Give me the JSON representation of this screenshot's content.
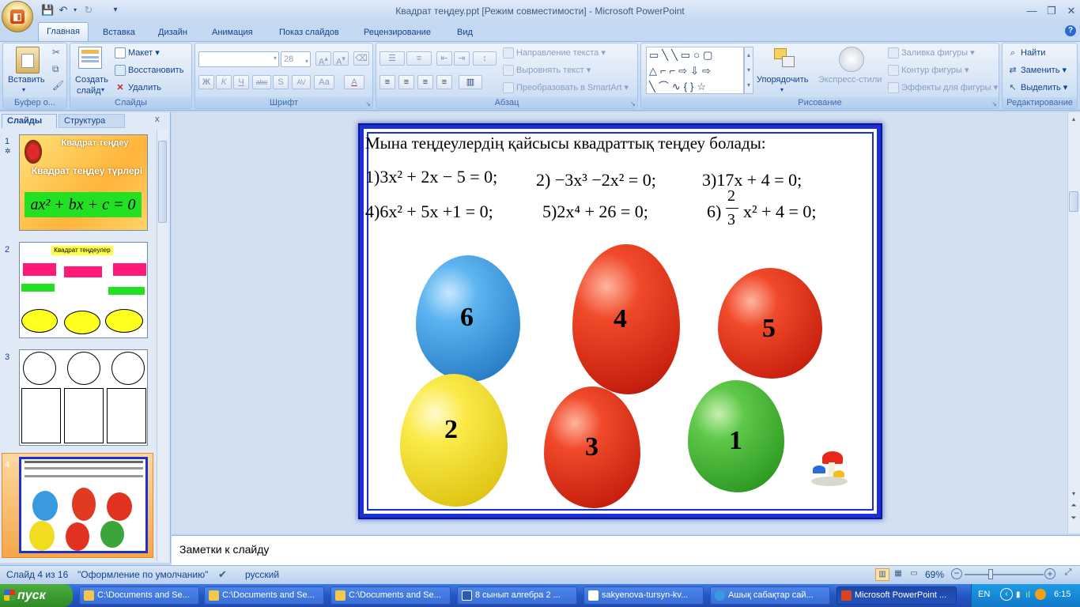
{
  "window": {
    "title": "Квадрат теңдеу.ppt [Режим совместимости] - Microsoft PowerPoint"
  },
  "tabs": [
    "Главная",
    "Вставка",
    "Дизайн",
    "Анимация",
    "Показ слайдов",
    "Рецензирование",
    "Вид"
  ],
  "ribbon": {
    "clipboard": {
      "label": "Буфер о...",
      "paste": "Вставить"
    },
    "slides": {
      "label": "Слайды",
      "new_slide_1": "Создать",
      "new_slide_2": "слайд",
      "layout": "Макет",
      "reset": "Восстановить",
      "delete": "Удалить"
    },
    "font": {
      "label": "Шрифт",
      "font_size": "28"
    },
    "paragraph": {
      "label": "Абзац",
      "text_direction": "Направление текста",
      "align_text": "Выровнять текст",
      "smartart": "Преобразовать в SmartArt"
    },
    "drawing": {
      "label": "Рисование",
      "arrange": "Упорядочить",
      "quick_styles": "Экспресс-стили",
      "shape_fill": "Заливка фигуры",
      "shape_outline": "Контур фигуры",
      "shape_effects": "Эффекты для фигуры"
    },
    "editing": {
      "label": "Редактирование",
      "find": "Найти",
      "replace": "Заменить",
      "select": "Выделить"
    }
  },
  "left_panel": {
    "tab_slides": "Слайды",
    "tab_outline": "Структура",
    "thumbs": [
      {
        "num": "1",
        "title_line1": "Квадрат теңдеу",
        "title_line2": "Квадрат теңдеу түрлері",
        "formula": "ax² + bx + c = 0"
      },
      {
        "num": "2",
        "title": "Квадрат теңдеулер"
      },
      {
        "num": "3"
      },
      {
        "num": "4"
      }
    ]
  },
  "slide": {
    "heading": "Мына теңдеулердің қайсысы квадраттық теңдеу болады:",
    "eq1": "1)3x² + 2x − 5 = 0;",
    "eq2": "2) −3x³ −2x² = 0;",
    "eq3": "3)17x + 4 = 0;",
    "eq4": "4)6x² + 5x +1 = 0;",
    "eq5": "5)2x⁴ + 26 = 0;",
    "eq6_prefix": "6)",
    "eq6_num": "2",
    "eq6_den": "3",
    "eq6_rest": "x² + 4 = 0;",
    "balloons": [
      {
        "label": "6",
        "color": "#3a9ae0"
      },
      {
        "label": "4",
        "color": "#e03a22"
      },
      {
        "label": "5",
        "color": "#e0321e"
      },
      {
        "label": "2",
        "color": "#f2dc22"
      },
      {
        "label": "3",
        "color": "#e0321e"
      },
      {
        "label": "1",
        "color": "#3aa53a"
      }
    ]
  },
  "notes": {
    "placeholder": "Заметки к слайду"
  },
  "statusbar": {
    "slide_info": "Слайд 4 из 16",
    "theme": "\"Оформление по умолчанию\"",
    "language": "русский",
    "zoom": "69%"
  },
  "taskbar": {
    "start": "пуск",
    "tasks": [
      "C:\\Documents and Se...",
      "C:\\Documents and Se...",
      "C:\\Documents and Se...",
      "8 сынып алгебра 2 ...",
      "sakyenova-tursyn-kv...",
      "Ашық сабақтар сай...",
      "Microsoft PowerPoint ..."
    ],
    "lang": "EN",
    "clock": "6:15"
  }
}
